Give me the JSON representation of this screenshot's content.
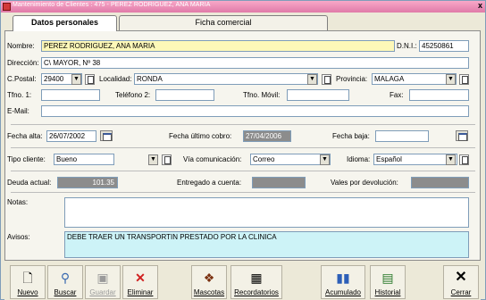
{
  "window": {
    "title": "Mantenimiento de Clientes : 475 - PEREZ RODRIGUEZ, ANA MARIA",
    "close": "x"
  },
  "tabs": [
    {
      "label": "Datos personales",
      "active": true
    },
    {
      "label": "Ficha comercial",
      "active": false
    }
  ],
  "form": {
    "nombre": {
      "label": "Nombre:",
      "value": "PEREZ RODRIGUEZ, ANA MARIA"
    },
    "dni": {
      "label": "D.N.I.:",
      "value": "45250861"
    },
    "direccion": {
      "label": "Dirección:",
      "value": "C\\ MAYOR, Nº 38"
    },
    "cpostal": {
      "label": "C.Postal:",
      "value": "29400"
    },
    "localidad": {
      "label": "Localidad:",
      "value": "RONDA"
    },
    "provincia": {
      "label": "Provincia:",
      "value": "MALAGA"
    },
    "tfno1": {
      "label": "Tfno. 1:",
      "value": ""
    },
    "telefono2": {
      "label": "Teléfono 2:",
      "value": ""
    },
    "movil": {
      "label": "Tfno. Móvil:",
      "value": ""
    },
    "fax": {
      "label": "Fax:",
      "value": ""
    },
    "email": {
      "label": "E-Mail:",
      "value": ""
    },
    "fecha_alta": {
      "label": "Fecha alta:",
      "value": "26/07/2002"
    },
    "fecha_ultimo_cobro": {
      "label": "Fecha último cobro:",
      "value": "27/04/2006"
    },
    "fecha_baja": {
      "label": "Fecha baja:",
      "value": ""
    },
    "tipo_cliente": {
      "label": "Tipo cliente:",
      "value": "Bueno"
    },
    "via_comunicacion": {
      "label": "Vía comunicación:",
      "value": "Correo"
    },
    "idioma": {
      "label": "Idioma:",
      "value": "Español"
    },
    "deuda_actual": {
      "label": "Deuda actual:",
      "value": "101.35"
    },
    "entregado_cuenta": {
      "label": "Entregado a cuenta:",
      "value": ""
    },
    "vales_devolucion": {
      "label": "Vales por devolución:",
      "value": ""
    },
    "notas": {
      "label": "Notas:",
      "value": ""
    },
    "avisos": {
      "label": "Avisos:",
      "value": "DEBE TRAER UN TRANSPORTIN PRESTADO POR LA CLINICA"
    }
  },
  "toolbar": [
    {
      "label": "Nuevo",
      "icon": "new-document-icon",
      "enabled": true
    },
    {
      "label": "Buscar",
      "icon": "magnifier-icon",
      "enabled": true
    },
    {
      "label": "Guardar",
      "icon": "floppy-disk-icon",
      "enabled": false
    },
    {
      "label": "Eliminar",
      "icon": "red-x-icon",
      "enabled": true
    },
    {
      "label": "Mascotas",
      "icon": "paw-icon",
      "enabled": true
    },
    {
      "label": "Recordatorios",
      "icon": "calendar-icon",
      "enabled": true
    },
    {
      "label": "Acumulado",
      "icon": "bar-chart-icon",
      "enabled": true
    },
    {
      "label": "Historial",
      "icon": "history-book-icon",
      "enabled": true
    },
    {
      "label": "Cerrar",
      "icon": "close-x-icon",
      "enabled": true
    }
  ],
  "colors": {
    "title_bar": "#e07aa8",
    "name_field": "#fdf8b8",
    "avisos_field": "#cdf3f7",
    "readonly_field": "#8c8c8c"
  }
}
